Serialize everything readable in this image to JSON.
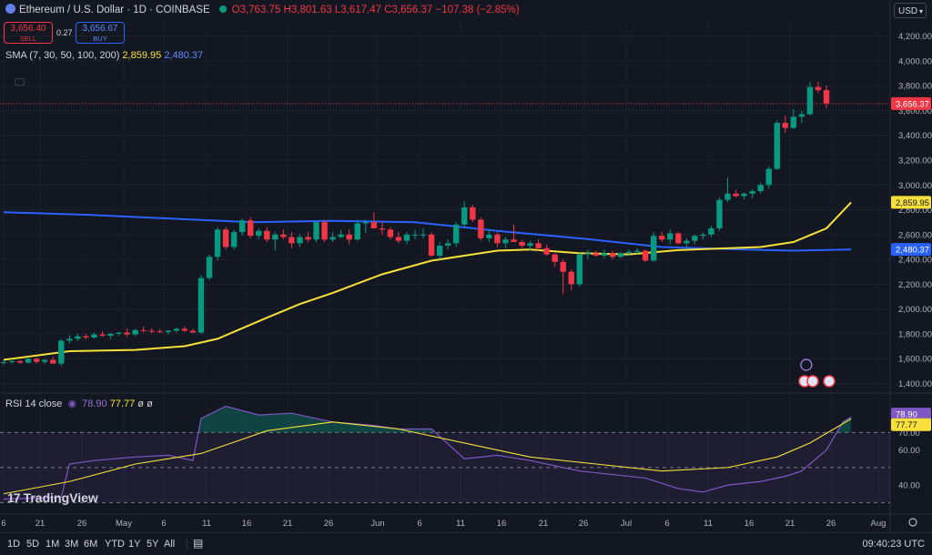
{
  "header": {
    "symbol": "Ethereum / U.S. Dollar · 1D · COINBASE",
    "open": "O3,763.75",
    "high": "H3,801.63",
    "low": "L3,617.47",
    "close": "C3,656.37",
    "change": "−107.38 (−2.85%)",
    "sell_price": "3,656.40",
    "sell_label": "SELL",
    "spread": "0.27",
    "buy_price": "3,656.67",
    "buy_label": "BUY",
    "currency": "USD"
  },
  "indicators": {
    "sma_label": "SMA (7, 30, 50, 100, 200)",
    "sma_a": "2,859.95",
    "sma_b": "2,480.37",
    "rsi_label": "RSI 14 close",
    "rsi_a": "78.90",
    "rsi_b": "77.77",
    "rsi_extra": "ø ø"
  },
  "branding": {
    "logo": "TradingView"
  },
  "timeframes": [
    "1D",
    "5D",
    "1M",
    "3M",
    "6M",
    "YTD",
    "1Y",
    "5Y",
    "All"
  ],
  "clock": "09:40:23 UTC",
  "colors": {
    "up": "#089981",
    "down": "#f23645",
    "sma_a": "#f7e03a",
    "sma_b": "#2962ff",
    "rsi": "#7e57c2",
    "bg": "#131722"
  },
  "chart_data": {
    "type": "candlestick",
    "price_axis": {
      "ticks": [
        1400,
        1600,
        1800,
        2000,
        2200,
        2400,
        2600,
        2800,
        3000,
        3200,
        3400,
        3600,
        3800,
        4000,
        4200
      ],
      "tick_labels": [
        "1,400.00",
        "1,600.00",
        "1,800.00",
        "2,000.00",
        "2,200.00",
        "2,400.00",
        "2,600.00",
        "2,800.00",
        "3,000.00",
        "3,200.00",
        "3,400.00",
        "3,600.00",
        "3,800.00",
        "4,000.00",
        "4,200.00"
      ],
      "range": [
        1330,
        4300
      ]
    },
    "rsi_axis": {
      "ticks": [
        40,
        60,
        70
      ],
      "tick_labels": [
        "40.00",
        "60.00",
        "70.00"
      ],
      "range": [
        25,
        92
      ],
      "bands": [
        30,
        50,
        70
      ]
    },
    "x_axis": {
      "tick_labels": [
        "6",
        "21",
        "26",
        "May",
        "6",
        "11",
        "16",
        "21",
        "26",
        "Jun",
        "6",
        "11",
        "16",
        "21",
        "26",
        "Jul",
        "6",
        "11",
        "16",
        "21",
        "26",
        "Aug"
      ]
    },
    "current_price": "3,656.37",
    "last_label_values": {
      "sma_a": "2,859.95",
      "sma_b": "2,480.37",
      "rsi_a": "78.90",
      "rsi_b": "77.77"
    },
    "candles": [
      [
        1566,
        1585,
        1552,
        1572
      ],
      [
        1572,
        1598,
        1560,
        1580
      ],
      [
        1580,
        1590,
        1555,
        1568
      ],
      [
        1568,
        1615,
        1560,
        1598
      ],
      [
        1598,
        1610,
        1560,
        1575
      ],
      [
        1575,
        1598,
        1555,
        1590
      ],
      [
        1590,
        1615,
        1570,
        1560
      ],
      [
        1560,
        1760,
        1540,
        1745
      ],
      [
        1745,
        1790,
        1720,
        1760
      ],
      [
        1760,
        1800,
        1740,
        1780
      ],
      [
        1780,
        1800,
        1755,
        1770
      ],
      [
        1770,
        1810,
        1760,
        1795
      ],
      [
        1795,
        1820,
        1775,
        1785
      ],
      [
        1785,
        1810,
        1760,
        1800
      ],
      [
        1800,
        1815,
        1785,
        1810
      ],
      [
        1810,
        1845,
        1775,
        1795
      ],
      [
        1795,
        1840,
        1780,
        1830
      ],
      [
        1830,
        1860,
        1810,
        1825
      ],
      [
        1825,
        1845,
        1805,
        1820
      ],
      [
        1820,
        1840,
        1805,
        1815
      ],
      [
        1815,
        1830,
        1795,
        1825
      ],
      [
        1825,
        1850,
        1810,
        1840
      ],
      [
        1840,
        1860,
        1815,
        1825
      ],
      [
        1825,
        1840,
        1810,
        1810
      ],
      [
        1810,
        2275,
        1800,
        2250
      ],
      [
        2250,
        2440,
        2230,
        2420
      ],
      [
        2420,
        2660,
        2390,
        2640
      ],
      [
        2640,
        2660,
        2480,
        2500
      ],
      [
        2500,
        2640,
        2480,
        2620
      ],
      [
        2620,
        2730,
        2590,
        2715
      ],
      [
        2715,
        2740,
        2570,
        2590
      ],
      [
        2590,
        2650,
        2560,
        2630
      ],
      [
        2630,
        2660,
        2540,
        2560
      ],
      [
        2560,
        2620,
        2470,
        2600
      ],
      [
        2600,
        2640,
        2560,
        2580
      ],
      [
        2580,
        2620,
        2490,
        2530
      ],
      [
        2530,
        2600,
        2500,
        2580
      ],
      [
        2580,
        2620,
        2540,
        2560
      ],
      [
        2560,
        2700,
        2540,
        2700
      ],
      [
        2700,
        2720,
        2540,
        2560
      ],
      [
        2560,
        2620,
        2540,
        2580
      ],
      [
        2580,
        2640,
        2570,
        2600
      ],
      [
        2600,
        2640,
        2520,
        2560
      ],
      [
        2560,
        2720,
        2550,
        2690
      ],
      [
        2690,
        2720,
        2610,
        2700
      ],
      [
        2700,
        2780,
        2650,
        2650
      ],
      [
        2650,
        2700,
        2600,
        2640
      ],
      [
        2640,
        2660,
        2560,
        2580
      ],
      [
        2580,
        2620,
        2530,
        2550
      ],
      [
        2550,
        2620,
        2520,
        2600
      ],
      [
        2600,
        2640,
        2560,
        2600
      ],
      [
        2600,
        2650,
        2570,
        2600
      ],
      [
        2600,
        2620,
        2420,
        2430
      ],
      [
        2430,
        2540,
        2400,
        2510
      ],
      [
        2510,
        2560,
        2480,
        2530
      ],
      [
        2530,
        2700,
        2500,
        2680
      ],
      [
        2680,
        2870,
        2660,
        2820
      ],
      [
        2820,
        2840,
        2700,
        2720
      ],
      [
        2720,
        2740,
        2550,
        2570
      ],
      [
        2570,
        2640,
        2540,
        2600
      ],
      [
        2600,
        2620,
        2500,
        2530
      ],
      [
        2530,
        2580,
        2490,
        2560
      ],
      [
        2560,
        2680,
        2540,
        2540
      ],
      [
        2540,
        2560,
        2490,
        2510
      ],
      [
        2510,
        2550,
        2470,
        2530
      ],
      [
        2530,
        2560,
        2470,
        2490
      ],
      [
        2490,
        2520,
        2430,
        2440
      ],
      [
        2440,
        2450,
        2340,
        2380
      ],
      [
        2380,
        2400,
        2120,
        2300
      ],
      [
        2300,
        2320,
        2150,
        2200
      ],
      [
        2200,
        2460,
        2180,
        2440
      ],
      [
        2440,
        2480,
        2400,
        2450
      ],
      [
        2450,
        2470,
        2420,
        2430
      ],
      [
        2430,
        2480,
        2410,
        2450
      ],
      [
        2450,
        2470,
        2400,
        2420
      ],
      [
        2420,
        2460,
        2410,
        2450
      ],
      [
        2450,
        2480,
        2430,
        2460
      ],
      [
        2460,
        2490,
        2440,
        2470
      ],
      [
        2470,
        2480,
        2380,
        2390
      ],
      [
        2390,
        2620,
        2380,
        2590
      ],
      [
        2590,
        2620,
        2540,
        2560
      ],
      [
        2560,
        2640,
        2520,
        2610
      ],
      [
        2610,
        2620,
        2520,
        2530
      ],
      [
        2530,
        2570,
        2480,
        2550
      ],
      [
        2550,
        2600,
        2520,
        2590
      ],
      [
        2590,
        2620,
        2560,
        2600
      ],
      [
        2600,
        2670,
        2580,
        2650
      ],
      [
        2650,
        2900,
        2630,
        2880
      ],
      [
        2880,
        3060,
        2860,
        2930
      ],
      [
        2930,
        2960,
        2900,
        2910
      ],
      [
        2910,
        2940,
        2880,
        2930
      ],
      [
        2930,
        2970,
        2890,
        2950
      ],
      [
        2950,
        3020,
        2930,
        3000
      ],
      [
        3000,
        3150,
        2970,
        3130
      ],
      [
        3130,
        3520,
        3120,
        3500
      ],
      [
        3500,
        3560,
        3420,
        3460
      ],
      [
        3460,
        3610,
        3450,
        3550
      ],
      [
        3550,
        3600,
        3500,
        3570
      ],
      [
        3570,
        3830,
        3560,
        3790
      ],
      [
        3790,
        3830,
        3740,
        3764
      ],
      [
        3764,
        3802,
        3617,
        3656
      ]
    ],
    "sma_a": [
      [
        0,
        1590
      ],
      [
        8,
        1660
      ],
      [
        16,
        1670
      ],
      [
        22,
        1700
      ],
      [
        26,
        1760
      ],
      [
        32,
        1930
      ],
      [
        36,
        2040
      ],
      [
        40,
        2130
      ],
      [
        46,
        2280
      ],
      [
        52,
        2390
      ],
      [
        56,
        2430
      ],
      [
        60,
        2470
      ],
      [
        64,
        2480
      ],
      [
        70,
        2450
      ],
      [
        76,
        2440
      ],
      [
        82,
        2475
      ],
      [
        86,
        2485
      ],
      [
        92,
        2500
      ],
      [
        96,
        2540
      ],
      [
        100,
        2650
      ],
      [
        103,
        2860
      ]
    ],
    "sma_b": [
      [
        0,
        2780
      ],
      [
        10,
        2760
      ],
      [
        20,
        2730
      ],
      [
        30,
        2700
      ],
      [
        40,
        2710
      ],
      [
        50,
        2700
      ],
      [
        60,
        2630
      ],
      [
        70,
        2570
      ],
      [
        80,
        2500
      ],
      [
        90,
        2480
      ],
      [
        96,
        2470
      ],
      [
        103,
        2480
      ]
    ],
    "rsi": [
      [
        0,
        32
      ],
      [
        7,
        33
      ],
      [
        8,
        52
      ],
      [
        11,
        54
      ],
      [
        16,
        56
      ],
      [
        20,
        57
      ],
      [
        23,
        54
      ],
      [
        24,
        78
      ],
      [
        27,
        85
      ],
      [
        31,
        80
      ],
      [
        35,
        81
      ],
      [
        40,
        76
      ],
      [
        45,
        74
      ],
      [
        48,
        72
      ],
      [
        52,
        72
      ],
      [
        56,
        55
      ],
      [
        60,
        57
      ],
      [
        64,
        54
      ],
      [
        70,
        48
      ],
      [
        74,
        46
      ],
      [
        78,
        44
      ],
      [
        82,
        38
      ],
      [
        85,
        36
      ],
      [
        88,
        40
      ],
      [
        92,
        42
      ],
      [
        95,
        45
      ],
      [
        97,
        48
      ],
      [
        100,
        60
      ],
      [
        102,
        76
      ],
      [
        103,
        78.9
      ]
    ],
    "rsi_ma": [
      [
        0,
        35
      ],
      [
        8,
        42
      ],
      [
        16,
        52
      ],
      [
        24,
        58
      ],
      [
        32,
        71
      ],
      [
        40,
        76
      ],
      [
        48,
        72
      ],
      [
        56,
        64
      ],
      [
        64,
        56
      ],
      [
        72,
        52
      ],
      [
        80,
        48
      ],
      [
        88,
        50
      ],
      [
        94,
        56
      ],
      [
        98,
        64
      ],
      [
        103,
        77.77
      ]
    ]
  }
}
